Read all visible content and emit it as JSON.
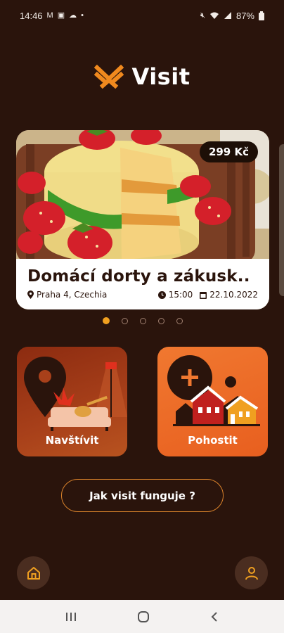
{
  "status_bar": {
    "time": "14:46",
    "battery": "87%"
  },
  "app": {
    "name": "Visit"
  },
  "carousel": {
    "price": "299 Kč",
    "title": "Domácí dorty a zákusk..",
    "location": "Praha 4, Czechia",
    "time": "15:00",
    "date": "22.10.2022",
    "pages": 5,
    "active_page": 1
  },
  "tiles": {
    "visit_label": "Navštívit",
    "host_label": "Pohostit"
  },
  "how_button_label": "Jak visit funguje ?",
  "colors": {
    "background": "#2a140c",
    "accent": "#f0a020",
    "visit_tile": "#a8401a",
    "host_tile": "#ee6c28"
  }
}
